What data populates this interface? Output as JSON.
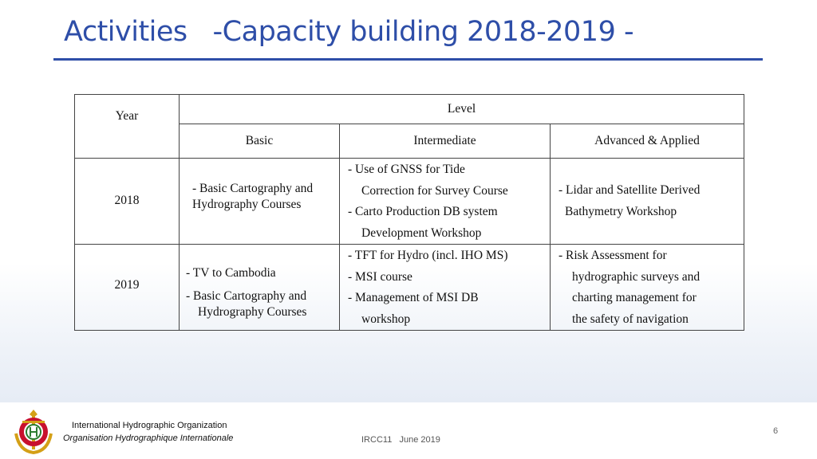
{
  "slide": {
    "title": "Activities   -Capacity building 2018-2019 -"
  },
  "table": {
    "headers": {
      "year": "Year",
      "level": "Level",
      "basic": "Basic",
      "intermediate": "Intermediate",
      "advanced": "Advanced & Applied"
    },
    "rows": [
      {
        "year": "2018",
        "basic": [
          "- Basic Cartography and",
          "Hydrography Courses"
        ],
        "intermediate": [
          "-   Use   of   GNSS   for   Tide",
          "Correction for Survey Course",
          "- Carto Production DB system",
          "Development Workshop"
        ],
        "advanced": [
          "- Lidar and Satellite Derived",
          "Bathymetry Workshop"
        ]
      },
      {
        "year": "2019",
        "basic": [
          "-  TV to Cambodia",
          "-  Basic Cartography and",
          "Hydrography Courses"
        ],
        "intermediate": [
          "- TFT for Hydro (incl. IHO MS)",
          "- MSI course",
          "-   Management   of   MSI   DB",
          "workshop"
        ],
        "advanced": [
          "-     Risk     Assessment     for",
          "hydrographic  surveys  and",
          "charting management   for",
          "the safety of navigation"
        ]
      }
    ]
  },
  "footer": {
    "org_en": "International Hydrographic Organization",
    "org_fr": "Organisation Hydrographique Internationale",
    "event": "IRCC11   June 2019",
    "page": "6"
  },
  "colors": {
    "title": "#2e4ea8",
    "logo_red": "#c8102e",
    "logo_gold": "#d4a017",
    "logo_green": "#2e7d32"
  },
  "icons": {
    "logo": "iho-emblem-logo"
  }
}
